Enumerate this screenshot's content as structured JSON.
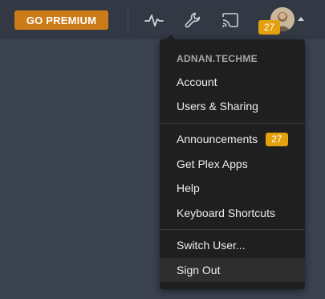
{
  "topbar": {
    "premium_label": "GO PREMIUM",
    "activity_icon": "activity-icon",
    "settings_icon": "wrench-icon",
    "cast_icon": "cast-icon",
    "avatar_badge": "27"
  },
  "menu": {
    "username": "ADNAN.TECHME",
    "items": [
      {
        "label": "Account"
      },
      {
        "label": "Users & Sharing"
      },
      {
        "label": "Announcements",
        "badge": "27"
      },
      {
        "label": "Get Plex Apps"
      },
      {
        "label": "Help"
      },
      {
        "label": "Keyboard Shortcuts"
      },
      {
        "label": "Switch User..."
      },
      {
        "label": "Sign Out"
      }
    ]
  },
  "colors": {
    "accent": "#e5a00d",
    "premium": "#cc7b19",
    "topbar": "#323844",
    "background": "#3b4250",
    "menu": "#1f1f1f"
  }
}
